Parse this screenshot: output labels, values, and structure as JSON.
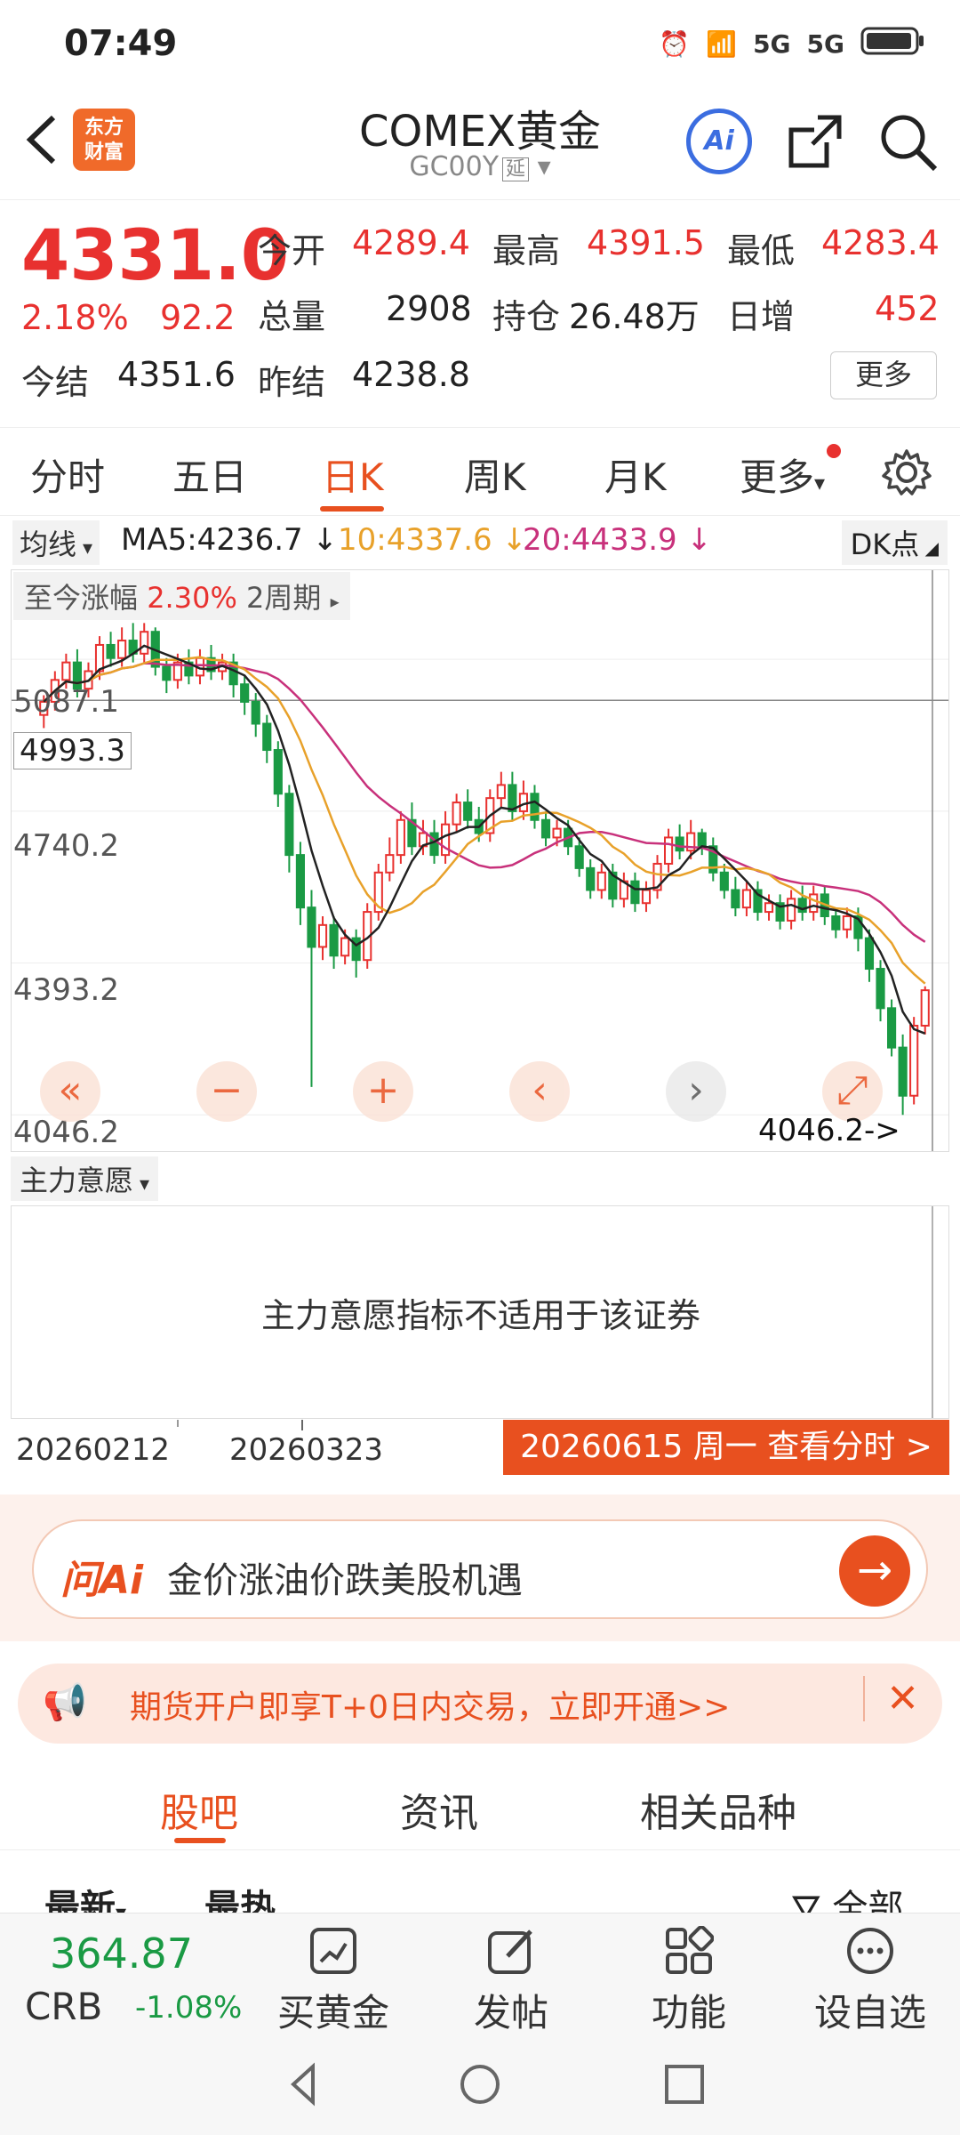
{
  "status_bar": {
    "time": "07:49",
    "net1": "5G",
    "net2": "5G"
  },
  "header": {
    "title": "COMEX黄金",
    "code": "GC00Y",
    "delay_tag": "延",
    "logo_line1": "东方",
    "logo_line2": "财富",
    "ai_label": "Ai"
  },
  "quote": {
    "last": "4331.0",
    "chg_pct": "2.18%",
    "chg": "92.2",
    "open_label": "今开",
    "open": "4289.4",
    "high_label": "最高",
    "high": "4391.5",
    "low_label": "最低",
    "low": "4283.4",
    "volume_label": "总量",
    "volume": "2908",
    "oi_label": "持仓",
    "oi": "26.48万",
    "daily_add_label": "日增",
    "daily_add": "452",
    "settle_label": "今结",
    "settle": "4351.6",
    "prev_settle_label": "昨结",
    "prev_settle": "4238.8",
    "more": "更多"
  },
  "tabs": [
    "分时",
    "五日",
    "日K",
    "周K",
    "月K",
    "更多"
  ],
  "ma": {
    "type": "均线",
    "ma5": "MA5:4236.7 ↓",
    "ma10": "10:4337.6 ↓",
    "ma20": "20:4433.9 ↓",
    "dk": "DK点"
  },
  "chart_overlay": {
    "range_label": "至今涨幅",
    "range_pct": "2.30%",
    "range_period": "2周期"
  },
  "chart_data": {
    "type": "candlestick",
    "y_ticks": [
      "5087.1",
      "4740.2",
      "4393.2",
      "4046.2"
    ],
    "crosshair_price": "4993.3",
    "low_marker": "4046.2->",
    "ylim": [
      4046.2,
      5087.1
    ],
    "x_ticks": [
      "20260212",
      "20260323"
    ],
    "series": [
      {
        "name": "MA5",
        "color": "#222222"
      },
      {
        "name": "10",
        "color": "#e8a12a"
      },
      {
        "name": "20",
        "color": "#c8317b"
      }
    ],
    "candles": [
      [
        4960,
        4990,
        4930,
        5005
      ],
      [
        4990,
        5040,
        4970,
        5060
      ],
      [
        5040,
        5080,
        5020,
        5100
      ],
      [
        5080,
        5020,
        5000,
        5110
      ],
      [
        5020,
        5060,
        5000,
        5080
      ],
      [
        5060,
        5120,
        5040,
        5140
      ],
      [
        5120,
        5090,
        5070,
        5150
      ],
      [
        5090,
        5130,
        5070,
        5160
      ],
      [
        5130,
        5100,
        5080,
        5170
      ],
      [
        5100,
        5150,
        5080,
        5170
      ],
      [
        5150,
        5070,
        5050,
        5160
      ],
      [
        5070,
        5040,
        5010,
        5090
      ],
      [
        5040,
        5080,
        5020,
        5100
      ],
      [
        5080,
        5050,
        5030,
        5110
      ],
      [
        5050,
        5090,
        5030,
        5110
      ],
      [
        5090,
        5060,
        5040,
        5120
      ],
      [
        5060,
        5080,
        5040,
        5100
      ],
      [
        5080,
        5030,
        5000,
        5100
      ],
      [
        5030,
        4990,
        4960,
        5050
      ],
      [
        4990,
        4940,
        4910,
        5010
      ],
      [
        4940,
        4880,
        4850,
        4960
      ],
      [
        4880,
        4780,
        4750,
        4900
      ],
      [
        4780,
        4640,
        4600,
        4800
      ],
      [
        4640,
        4520,
        4480,
        4670
      ],
      [
        4520,
        4430,
        4110,
        4560
      ],
      [
        4430,
        4480,
        4400,
        4500
      ],
      [
        4480,
        4410,
        4380,
        4500
      ],
      [
        4410,
        4450,
        4390,
        4470
      ],
      [
        4450,
        4400,
        4360,
        4470
      ],
      [
        4400,
        4510,
        4380,
        4530
      ],
      [
        4510,
        4600,
        4490,
        4620
      ],
      [
        4600,
        4640,
        4580,
        4680
      ],
      [
        4640,
        4720,
        4620,
        4740
      ],
      [
        4720,
        4660,
        4640,
        4760
      ],
      [
        4660,
        4690,
        4640,
        4720
      ],
      [
        4690,
        4640,
        4620,
        4720
      ],
      [
        4640,
        4710,
        4620,
        4740
      ],
      [
        4710,
        4760,
        4690,
        4780
      ],
      [
        4760,
        4720,
        4700,
        4790
      ],
      [
        4720,
        4690,
        4670,
        4750
      ],
      [
        4690,
        4770,
        4670,
        4790
      ],
      [
        4770,
        4800,
        4750,
        4830
      ],
      [
        4800,
        4740,
        4720,
        4830
      ],
      [
        4740,
        4780,
        4720,
        4810
      ],
      [
        4780,
        4720,
        4700,
        4800
      ],
      [
        4720,
        4680,
        4660,
        4740
      ],
      [
        4680,
        4700,
        4660,
        4720
      ],
      [
        4700,
        4660,
        4640,
        4720
      ],
      [
        4660,
        4610,
        4590,
        4680
      ],
      [
        4610,
        4560,
        4540,
        4630
      ],
      [
        4560,
        4600,
        4540,
        4620
      ],
      [
        4600,
        4540,
        4520,
        4620
      ],
      [
        4540,
        4580,
        4520,
        4600
      ],
      [
        4580,
        4530,
        4510,
        4600
      ],
      [
        4530,
        4560,
        4510,
        4580
      ],
      [
        4560,
        4620,
        4540,
        4640
      ],
      [
        4620,
        4680,
        4600,
        4700
      ],
      [
        4680,
        4650,
        4630,
        4710
      ],
      [
        4650,
        4690,
        4630,
        4720
      ],
      [
        4690,
        4660,
        4640,
        4700
      ],
      [
        4660,
        4600,
        4580,
        4680
      ],
      [
        4600,
        4560,
        4540,
        4620
      ],
      [
        4560,
        4520,
        4500,
        4590
      ],
      [
        4520,
        4560,
        4500,
        4580
      ],
      [
        4560,
        4510,
        4490,
        4580
      ],
      [
        4510,
        4530,
        4490,
        4550
      ],
      [
        4530,
        4490,
        4470,
        4550
      ],
      [
        4490,
        4540,
        4470,
        4560
      ],
      [
        4540,
        4510,
        4490,
        4570
      ],
      [
        4510,
        4550,
        4490,
        4570
      ],
      [
        4550,
        4500,
        4480,
        4570
      ],
      [
        4500,
        4470,
        4450,
        4520
      ],
      [
        4470,
        4500,
        4450,
        4520
      ],
      [
        4500,
        4450,
        4420,
        4520
      ],
      [
        4450,
        4380,
        4350,
        4470
      ],
      [
        4380,
        4290,
        4260,
        4400
      ],
      [
        4290,
        4200,
        4180,
        4310
      ],
      [
        4200,
        4090,
        4046.2,
        4230
      ],
      [
        4090,
        4250,
        4070,
        4270
      ],
      [
        4250,
        4331,
        4230,
        4340
      ]
    ]
  },
  "indicator": {
    "select": "主力意愿",
    "message": "主力意愿指标不适用于该证券"
  },
  "date_axis": {
    "d1": "20260212",
    "d2": "20260323",
    "cursor": "20260615 周一 查看分时 >"
  },
  "ask_ai": {
    "logo": "问Ai",
    "text": "金价涨油价跌美股机遇"
  },
  "promo": {
    "text": "期货开户即享T+0日内交易，立即开通>>"
  },
  "community_tabs": [
    "股吧",
    "资讯",
    "相关品种"
  ],
  "sub_tabs": [
    "最新",
    "最热",
    "全部"
  ],
  "bottom_bar": {
    "crb_value": "364.87",
    "crb_name": "CRB",
    "crb_chg": "-1.08%",
    "items": [
      "买黄金",
      "发帖",
      "功能",
      "设自选"
    ]
  }
}
